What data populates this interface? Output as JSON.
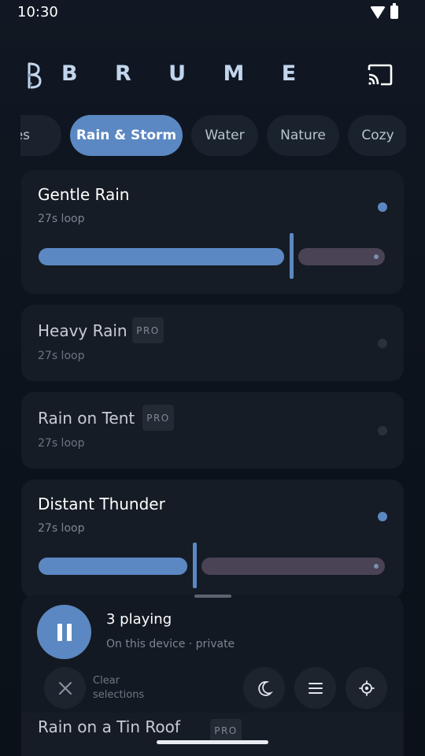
{
  "status_bar": {
    "time": "10:30"
  },
  "app": {
    "logo_text": "B R U M E"
  },
  "tabs": [
    {
      "label": "nes",
      "active": false
    },
    {
      "label": "Rain & Storm",
      "active": true
    },
    {
      "label": "Water",
      "active": false
    },
    {
      "label": "Nature",
      "active": false
    },
    {
      "label": "Cozy",
      "active": false
    }
  ],
  "sounds": [
    {
      "title": "Gentle Rain",
      "subtitle": "27s loop",
      "playing": true,
      "volume": 0.73
    },
    {
      "title": "Heavy Rain",
      "subtitle": "27s loop",
      "pro": "PRO",
      "playing": false
    },
    {
      "title": "Rain on Tent",
      "subtitle": "27s loop",
      "pro": "PRO",
      "playing": false
    },
    {
      "title": "Distant Thunder",
      "subtitle": "27s loop",
      "playing": true,
      "volume": 0.45
    },
    {
      "title": "Rain on a Tin Roof",
      "pro": "PRO",
      "playing": false
    }
  ],
  "player": {
    "title": "3 playing",
    "subtitle": "On this device · private",
    "clear_label": "Clear selections"
  },
  "icons": {
    "cast": "cast-icon",
    "pause": "pause-icon",
    "close": "close-icon",
    "moon": "moon-icon",
    "menu": "menu-icon",
    "settings": "settings-icon"
  },
  "colors": {
    "accent": "#5b88c2",
    "background": "#0d131c",
    "card": "#161c25",
    "slider_rest": "#4a4255"
  }
}
